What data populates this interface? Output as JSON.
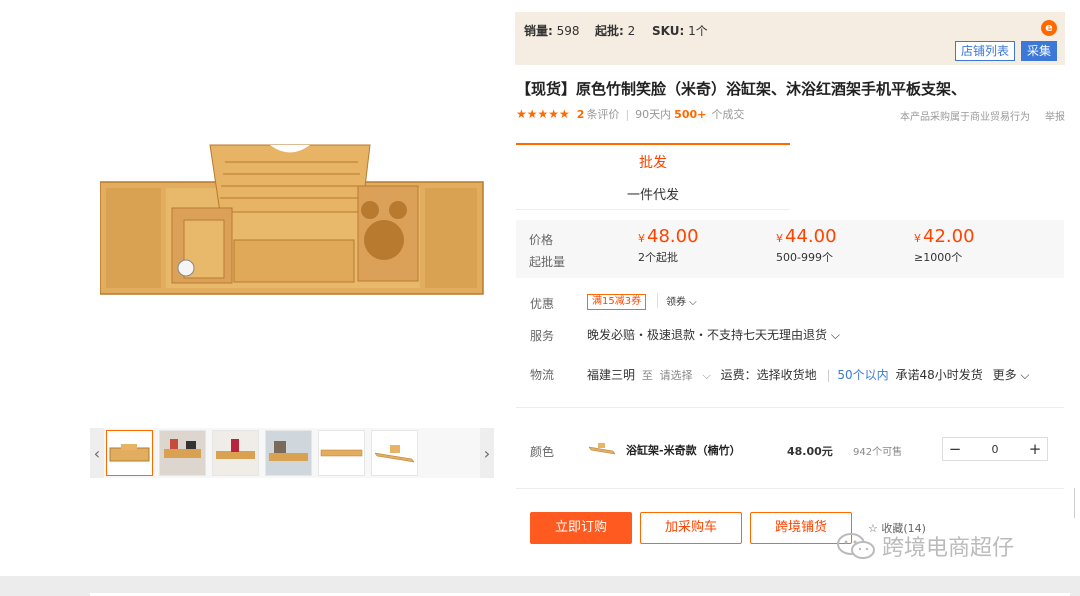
{
  "stats": {
    "sales_label": "销量:",
    "sales_value": "598",
    "min_label": "起批:",
    "min_value": "2",
    "sku_label": "SKU:",
    "sku_value": "1个"
  },
  "store_list_label": "店铺列表",
  "collect_label": "采集",
  "title": "【现货】原色竹制笑脸（米奇）浴缸架、沐浴红酒架手机平板支架、",
  "rating": {
    "stars": "★★★★★",
    "review_count": "2",
    "review_label": "条评价",
    "days_label": "90天内",
    "deals_count": "500+",
    "deals_label": "个成交"
  },
  "business_note": "本产品采购属于商业贸易行为",
  "report_label": "举报",
  "tabs": {
    "wholesale": "批发",
    "dropship": "一件代发"
  },
  "price_block": {
    "price_label": "价格",
    "moq_label": "起批量",
    "tiers": [
      {
        "currency": "¥",
        "price": "48.00",
        "moq": "2个起批"
      },
      {
        "currency": "¥",
        "price": "44.00",
        "moq": "500-999个"
      },
      {
        "currency": "¥",
        "price": "42.00",
        "moq": "≥1000个"
      }
    ]
  },
  "promo": {
    "label": "优惠",
    "coupon": "满15减3券",
    "get_coupon": "领券 ⌵"
  },
  "service": {
    "label": "服务",
    "text": "晚发必赔・极速退款・不支持七天无理由退货 ⌵"
  },
  "logistics": {
    "label": "物流",
    "from": "福建三明",
    "to_label": "至",
    "to_placeholder": "请选择",
    "fee": "运费：选择收货地",
    "ship_hint": "50个以内",
    "ship_promise": "承诺48小时发货",
    "more": "更多 ⌵"
  },
  "sku": {
    "label": "颜色",
    "name": "浴缸架-米奇款（楠竹）",
    "price": "48.00元",
    "stock": "942个可售",
    "quantity": "0",
    "minus": "−",
    "plus": "+"
  },
  "actions": {
    "buy": "立即订购",
    "cart": "加采购车",
    "cross": "跨境铺货",
    "favorite": "收藏(14)"
  },
  "watermark": "跨境电商超仔",
  "colors": {
    "accent": "#ff6a00",
    "price": "#ff4400",
    "link": "#3b78d8",
    "bamboo": "#e2ad5e"
  }
}
